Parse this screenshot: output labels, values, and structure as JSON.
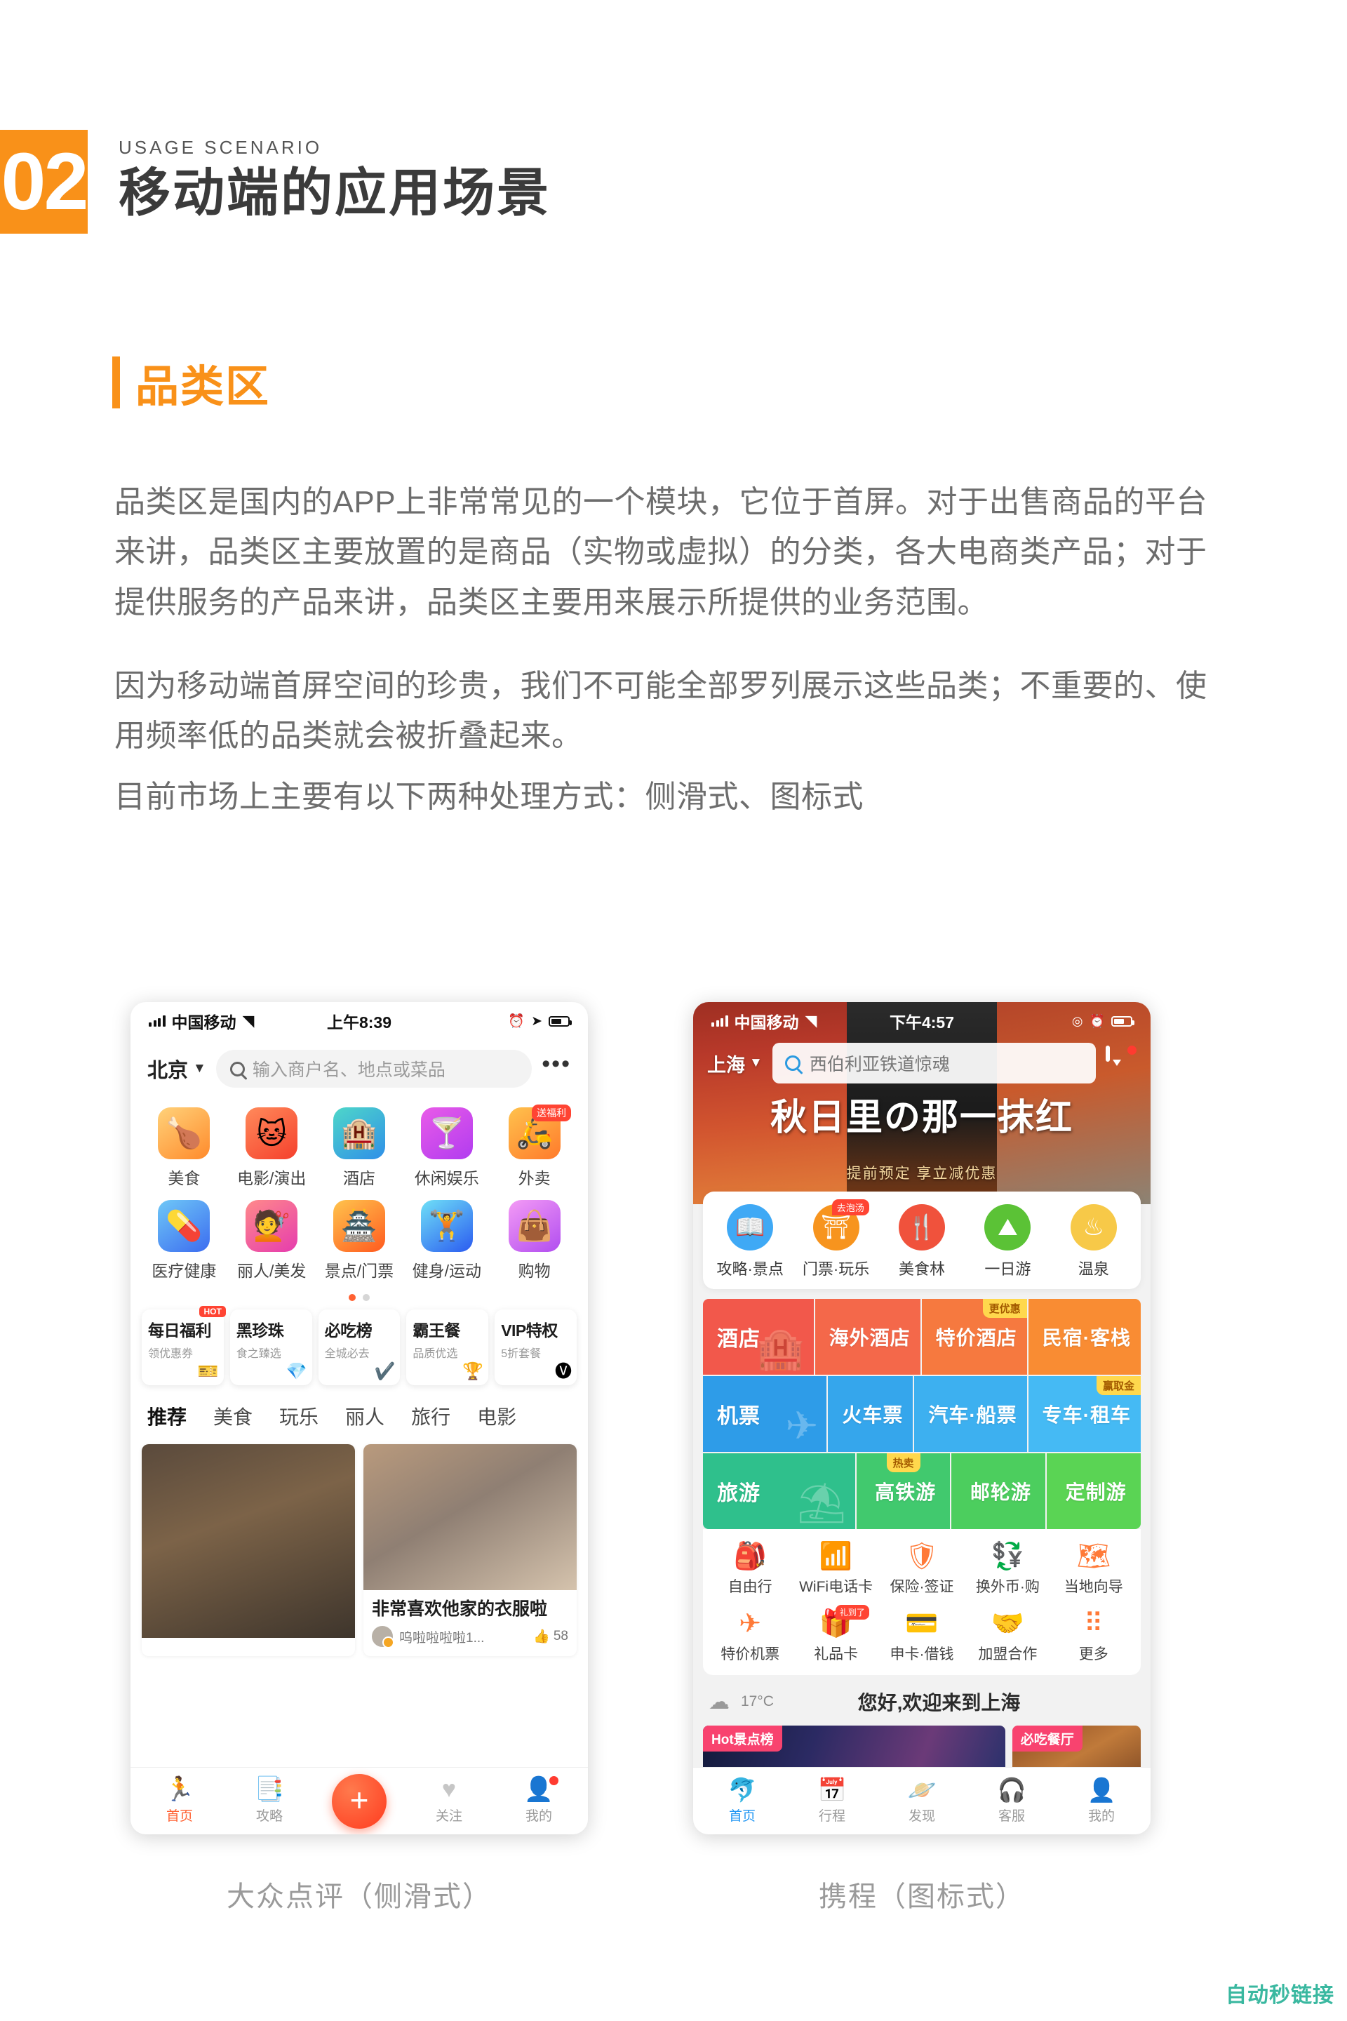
{
  "header": {
    "number": "02",
    "eyebrow": "USAGE SCENARIO",
    "title": "移动端的应用场景"
  },
  "section": {
    "title": "品类区"
  },
  "paragraphs": {
    "p1": "品类区是国内的APP上非常常见的一个模块，它位于首屏。对于出售商品的平台来讲，品类区主要放置的是商品（实物或虚拟）的分类，各大电商类产品；对于提供服务的产品来讲，品类区主要用来展示所提供的业务范围。",
    "p2": "因为移动端首屏空间的珍贵，我们不可能全部罗列展示这些品类；不重要的、使用频率低的品类就会被折叠起来。",
    "p3": "目前市场上主要有以下两种处理方式：侧滑式、图标式"
  },
  "dianping": {
    "caption": "大众点评（侧滑式）",
    "statusbar": {
      "carrier": "中国移动",
      "time": "上午8:39"
    },
    "topbar": {
      "city": "北京",
      "search_placeholder": "输入商户名、地点或菜品",
      "more": "•••"
    },
    "categories": [
      {
        "label": "美食",
        "icon": "🍗",
        "tag": "",
        "bg": "linear-gradient(145deg,#FFD27A,#FF8A2B)"
      },
      {
        "label": "电影/演出",
        "icon": "🐱",
        "tag": "",
        "bg": "linear-gradient(145deg,#FF8A5B,#F5402C)"
      },
      {
        "label": "酒店",
        "icon": "🏨",
        "tag": "",
        "bg": "linear-gradient(145deg,#4ED7C9,#2F8FE8)"
      },
      {
        "label": "休闲娱乐",
        "icon": "🍸",
        "tag": "",
        "bg": "linear-gradient(145deg,#E95BE8,#B13CF0)"
      },
      {
        "label": "外卖",
        "icon": "🛵",
        "tag": "送福利",
        "bg": "linear-gradient(145deg,#FFC24D,#FF7A2B)"
      },
      {
        "label": "医疗健康",
        "icon": "💊",
        "tag": "",
        "bg": "linear-gradient(145deg,#6FC8F7,#3C6CF0)"
      },
      {
        "label": "丽人/美发",
        "icon": "💇",
        "tag": "",
        "bg": "linear-gradient(145deg,#FF8A8A,#E63CAE)"
      },
      {
        "label": "景点/门票",
        "icon": "🏯",
        "tag": "",
        "bg": "linear-gradient(145deg,#FFC44D,#FF5A1F)"
      },
      {
        "label": "健身/运动",
        "icon": "🏋",
        "tag": "",
        "bg": "linear-gradient(145deg,#6FE0F7,#2B5BF0)"
      },
      {
        "label": "购物",
        "icon": "👜",
        "tag": "",
        "bg": "linear-gradient(145deg,#F49BF5,#B14DF0)"
      }
    ],
    "pager": {
      "total": 2,
      "active": 1
    },
    "promos": [
      {
        "title": "每日福利",
        "sub": "领优惠券",
        "emoji": "🎫",
        "hot": "HOT"
      },
      {
        "title": "黑珍珠",
        "sub": "食之臻选",
        "emoji": "💎",
        "hot": ""
      },
      {
        "title": "必吃榜",
        "sub": "全城必去",
        "emoji": "✔️",
        "hot": ""
      },
      {
        "title": "霸王餐",
        "sub": "品质优选",
        "emoji": "🏆",
        "hot": ""
      },
      {
        "title": "VIP特权",
        "sub": "5折套餐",
        "emoji": "🅥",
        "hot": ""
      }
    ],
    "tabs": [
      {
        "label": "推荐",
        "active": true
      },
      {
        "label": "美食",
        "active": false
      },
      {
        "label": "玩乐",
        "active": false
      },
      {
        "label": "丽人",
        "active": false
      },
      {
        "label": "旅行",
        "active": false
      },
      {
        "label": "电影",
        "active": false
      }
    ],
    "feed": [
      {
        "title": "",
        "user": "",
        "likes": ""
      },
      {
        "title": "非常喜欢他家的衣服啦",
        "user": "呜啦啦啦啦1...",
        "likes": "58"
      }
    ],
    "nav": [
      {
        "label": "首页",
        "icon": "🏃",
        "active": true,
        "dot": false
      },
      {
        "label": "攻略",
        "icon": "📑",
        "active": false,
        "dot": false
      },
      {
        "label": "",
        "icon": "+",
        "active": false,
        "dot": false
      },
      {
        "label": "关注",
        "icon": "♥",
        "active": false,
        "dot": false
      },
      {
        "label": "我的",
        "icon": "👤",
        "active": false,
        "dot": true
      }
    ]
  },
  "ctrip": {
    "caption": "携程（图标式）",
    "statusbar": {
      "carrier": "中国移动",
      "time": "下午4:57"
    },
    "topbar": {
      "city": "上海",
      "search_value": "西伯利亚铁道惊魂"
    },
    "banner": {
      "title": "秋日里の那一抹红",
      "subtitle": "提前预定 享立减优惠"
    },
    "round_icons": [
      {
        "label": "攻略·景点",
        "icon": "📖",
        "color": "#3FA9F5",
        "tag": ""
      },
      {
        "label": "门票·玩乐",
        "icon": "⛩",
        "color": "#F7941E",
        "tag": "去泡汤"
      },
      {
        "label": "美食林",
        "icon": "🍴",
        "color": "#F0523C",
        "tag": ""
      },
      {
        "label": "一日游",
        "icon": "⛰",
        "color": "#5BC236",
        "tag": ""
      },
      {
        "label": "温泉",
        "icon": "♨",
        "color": "#F7C948",
        "tag": ""
      }
    ],
    "tiles": [
      [
        {
          "label": "酒店",
          "bg": "#F2584B",
          "badge": "",
          "ghost": "🏨"
        },
        {
          "label": "海外酒店",
          "bg": "#F4684A",
          "badge": "",
          "ghost": ""
        },
        {
          "label": "特价酒店",
          "bg": "#F6793F",
          "badge": "更优惠",
          "ghost": ""
        },
        {
          "label": "民宿·客栈",
          "bg": "#F98C33",
          "badge": "",
          "ghost": ""
        }
      ],
      [
        {
          "label": "机票",
          "bg": "#2E9CE8",
          "badge": "",
          "ghost": "✈"
        },
        {
          "label": "火车票",
          "bg": "#35A6EC",
          "badge": "",
          "ghost": ""
        },
        {
          "label": "汽车·船票",
          "bg": "#3DB0F0",
          "badge": "",
          "ghost": ""
        },
        {
          "label": "专车·租车",
          "bg": "#45BAF4",
          "badge": "赢取金",
          "ghost": ""
        }
      ],
      [
        {
          "label": "旅游",
          "bg": "#2FC08C",
          "badge": "",
          "ghost": "⛱"
        },
        {
          "label": "高铁游",
          "bg": "#41C96E",
          "badge": "热卖",
          "ghost": ""
        },
        {
          "label": "邮轮游",
          "bg": "#4CCE5E",
          "badge": "",
          "ghost": ""
        },
        {
          "label": "定制游",
          "bg": "#5AD454",
          "badge": "",
          "ghost": ""
        }
      ]
    ],
    "mini_icons": [
      {
        "label": "自由行",
        "icon": "🎒",
        "tag": ""
      },
      {
        "label": "WiFi电话卡",
        "icon": "📶",
        "tag": ""
      },
      {
        "label": "保险·签证",
        "icon": "🛡",
        "tag": ""
      },
      {
        "label": "换外币·购",
        "icon": "💱",
        "tag": ""
      },
      {
        "label": "当地向导",
        "icon": "🗺",
        "tag": ""
      },
      {
        "label": "特价机票",
        "icon": "✈",
        "tag": ""
      },
      {
        "label": "礼品卡",
        "icon": "🎁",
        "tag": "礼到了"
      },
      {
        "label": "申卡·借钱",
        "icon": "💳",
        "tag": ""
      },
      {
        "label": "加盟合作",
        "icon": "🤝",
        "tag": ""
      },
      {
        "label": "更多",
        "icon": "⠿",
        "tag": ""
      }
    ],
    "weather": {
      "temp": "17°C",
      "greeting": "您好,欢迎来到上海"
    },
    "feed_banners": [
      {
        "pill": "Hot景点榜"
      },
      {
        "pill": "必吃餐厅"
      }
    ],
    "nav": [
      {
        "label": "首页",
        "icon": "🐬",
        "active": true
      },
      {
        "label": "行程",
        "icon": "📅",
        "active": false
      },
      {
        "label": "发现",
        "icon": "🪐",
        "active": false
      },
      {
        "label": "客服",
        "icon": "🎧",
        "active": false
      },
      {
        "label": "我的",
        "icon": "👤",
        "active": false
      }
    ]
  },
  "watermark": "自动秒链接"
}
